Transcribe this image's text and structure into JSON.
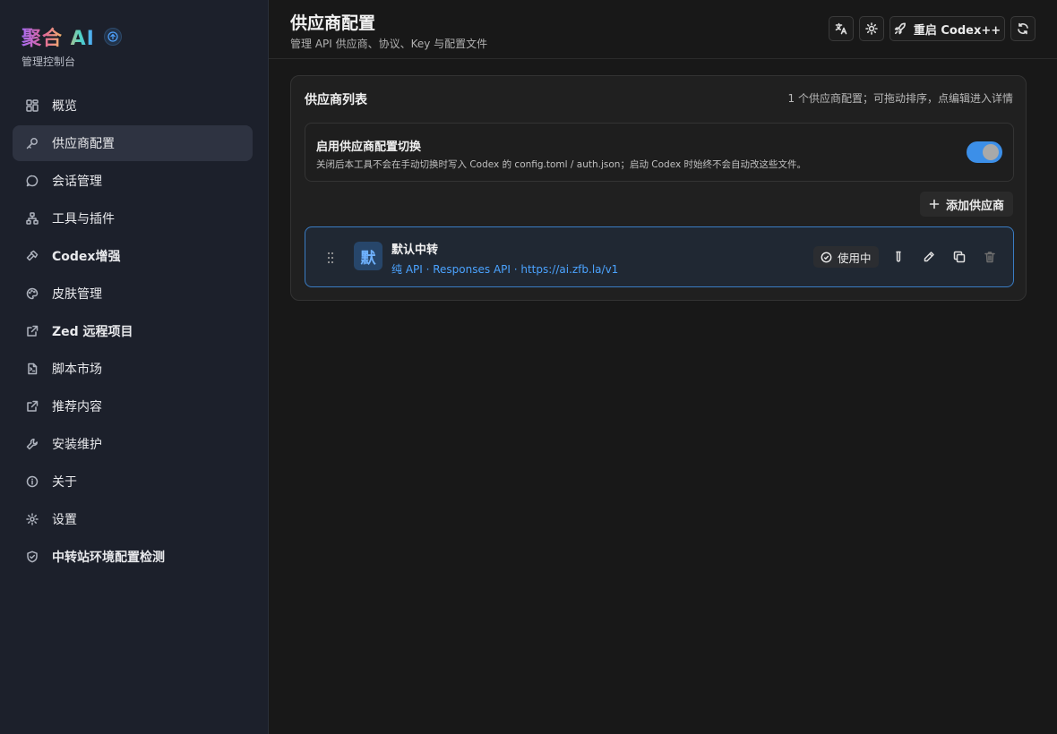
{
  "brand": {
    "title": "聚合 AI",
    "subtitle": "管理控制台"
  },
  "sidebar": {
    "items": [
      {
        "label": "概览",
        "icon": "grid-icon"
      },
      {
        "label": "供应商配置",
        "icon": "key-icon",
        "active": true
      },
      {
        "label": "会话管理",
        "icon": "chat-icon"
      },
      {
        "label": "工具与插件",
        "icon": "network-icon"
      },
      {
        "label": "Codex增强",
        "icon": "hammer-icon"
      },
      {
        "label": "皮肤管理",
        "icon": "palette-icon"
      },
      {
        "label": "Zed 远程项目",
        "icon": "external-link-icon"
      },
      {
        "label": "脚本市场",
        "icon": "file-script-icon"
      },
      {
        "label": "推荐内容",
        "icon": "external-link-icon"
      },
      {
        "label": "安装维护",
        "icon": "wrench-icon"
      },
      {
        "label": "关于",
        "icon": "info-icon"
      },
      {
        "label": "设置",
        "icon": "gear-icon"
      },
      {
        "label": "中转站环境配置检测",
        "icon": "shield-icon"
      }
    ]
  },
  "header": {
    "title": "供应商配置",
    "subtitle": "管理 API 供应商、协议、Key 与配置文件",
    "restart_label": "重启 Codex++"
  },
  "panel": {
    "title": "供应商列表",
    "note": "1 个供应商配置；可拖动排序，点编辑进入详情",
    "toggle_title": "启用供应商配置切换",
    "toggle_desc": "关闭后本工具不会在手动切换时写入 Codex 的 config.toml / auth.json；启动 Codex 时始终不会自动改这些文件。",
    "toggle_on": true,
    "add_label": "添加供应商"
  },
  "provider": {
    "avatar": "默",
    "name": "默认中转",
    "meta": "纯 API · Responses API · https://ai.zfb.la/v1",
    "status": "使用中"
  },
  "colors": {
    "accent": "#3c8fe8",
    "link": "#4ba3ff",
    "danger_muted": "#6e6e6e"
  }
}
